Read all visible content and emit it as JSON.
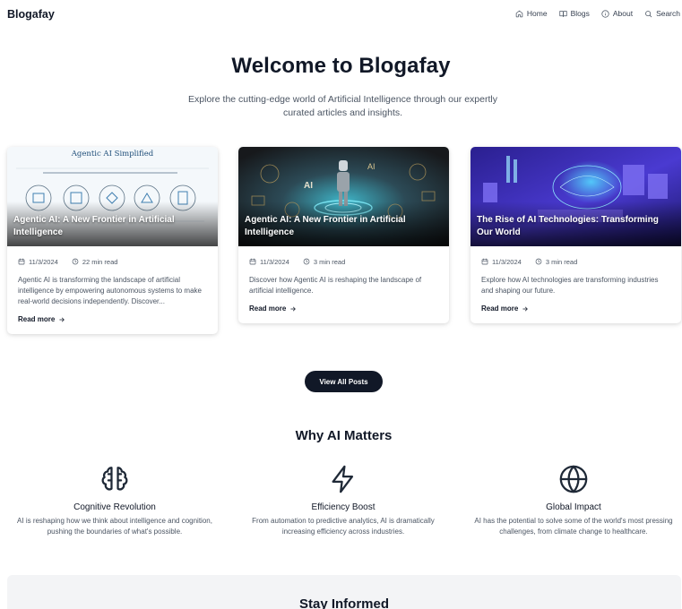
{
  "nav": {
    "brand": "Blogafay",
    "links": [
      {
        "label": "Home",
        "icon": "home-icon"
      },
      {
        "label": "Blogs",
        "icon": "book-icon"
      },
      {
        "label": "About",
        "icon": "info-icon"
      },
      {
        "label": "Search",
        "icon": "search-icon"
      }
    ]
  },
  "hero": {
    "title": "Welcome to Blogafay",
    "subtitle": "Explore the cutting-edge world of Artificial Intelligence through our expertly curated articles and insights."
  },
  "posts": [
    {
      "title": "Agentic AI: A New Frontier in Artificial Intelligence",
      "image_heading": "Agentic AI Simplified",
      "date": "11/3/2024",
      "read_time": "22 min read",
      "excerpt": "Agentic AI is transforming the landscape of artificial intelligence by empowering autonomous systems to make real-world decisions independently. Discover...",
      "cta": "Read more"
    },
    {
      "title": "Agentic AI: A New Frontier in Artificial Intelligence",
      "image_heading": "AI",
      "date": "11/3/2024",
      "read_time": "3 min read",
      "excerpt": "Discover how Agentic AI is reshaping the landscape of artificial intelligence.",
      "cta": "Read more"
    },
    {
      "title": "The Rise of AI Technologies: Transforming Our World",
      "date": "11/3/2024",
      "read_time": "3 min read",
      "excerpt": "Explore how AI technologies are transforming industries and shaping our future.",
      "cta": "Read more"
    }
  ],
  "view_all_label": "View All Posts",
  "why": {
    "title": "Why AI Matters",
    "features": [
      {
        "icon": "brain-icon",
        "title": "Cognitive Revolution",
        "desc": "AI is reshaping how we think about intelligence and cognition, pushing the boundaries of what's possible."
      },
      {
        "icon": "zap-icon",
        "title": "Efficiency Boost",
        "desc": "From automation to predictive analytics, AI is dramatically increasing efficiency across industries."
      },
      {
        "icon": "globe-icon",
        "title": "Global Impact",
        "desc": "AI has the potential to solve some of the world's most pressing challenges, from climate change to healthcare."
      }
    ]
  },
  "newsletter": {
    "title": "Stay Informed"
  },
  "colors": {
    "primary": "#111827",
    "muted": "#4b5563",
    "section_bg": "#f3f4f6"
  }
}
